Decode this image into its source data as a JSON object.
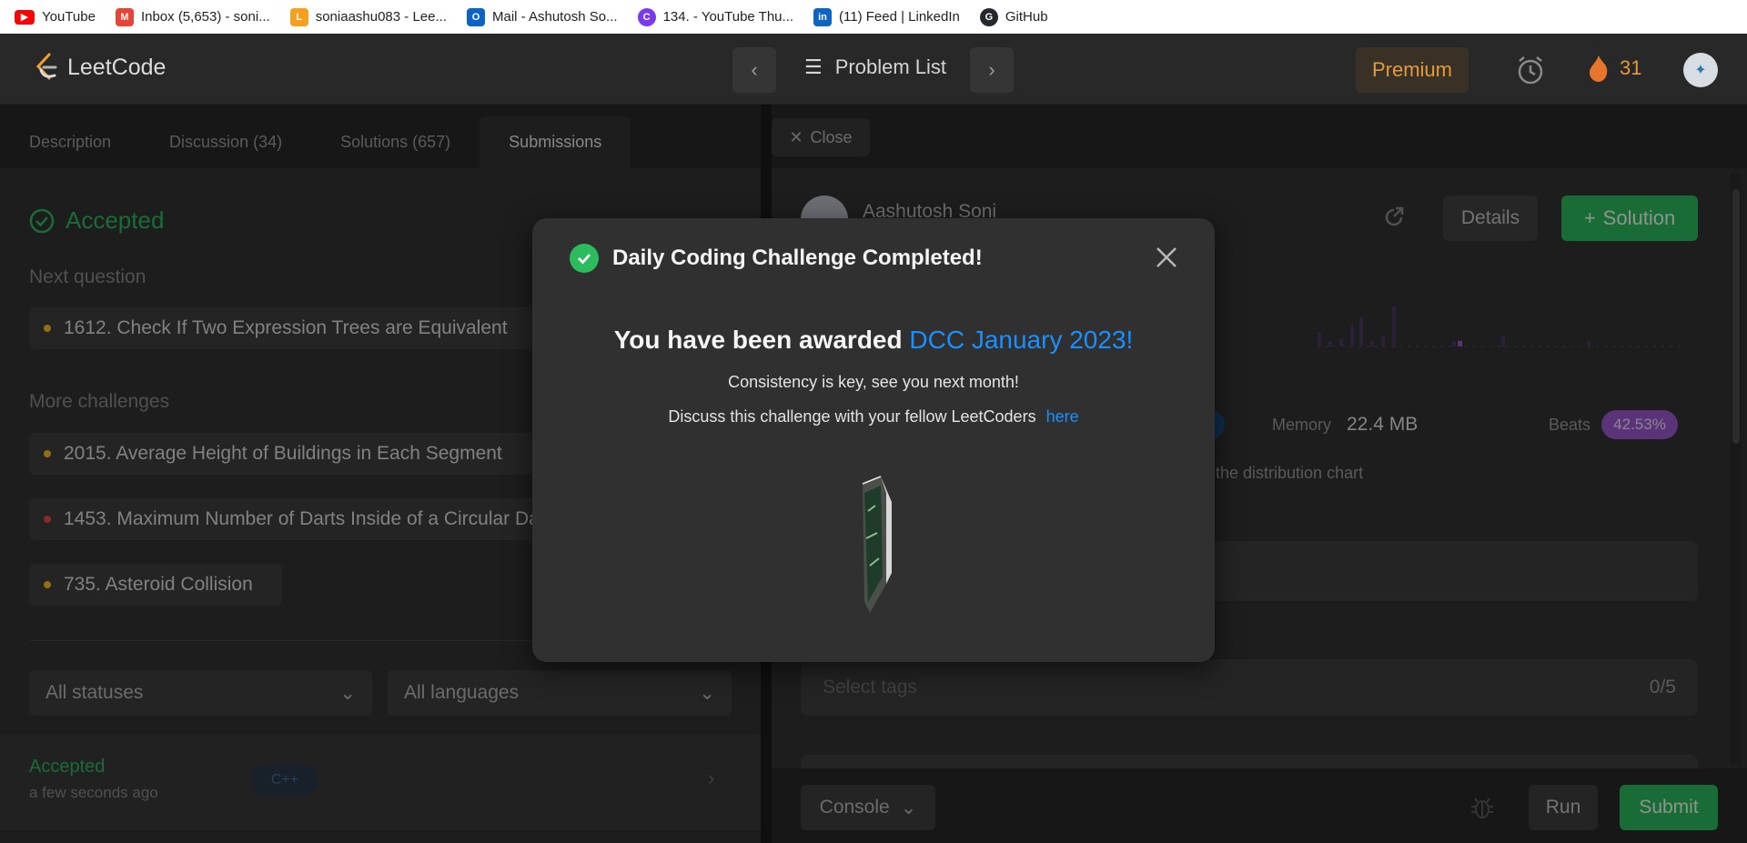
{
  "bookmarks": [
    {
      "label": "YouTube",
      "icon": "youtube-icon",
      "color": "#ff0000"
    },
    {
      "label": "Inbox (5,653) - soni...",
      "icon": "gmail-icon",
      "color": "#ea4335"
    },
    {
      "label": "soniaashu083 - Lee...",
      "icon": "leetcode-icon",
      "color": "#f89f1b"
    },
    {
      "label": "Mail - Ashutosh So...",
      "icon": "outlook-icon",
      "color": "#0a64c8"
    },
    {
      "label": "134. - YouTube Thu...",
      "icon": "canva-icon",
      "color": "#7c3aed"
    },
    {
      "label": "(11) Feed | LinkedIn",
      "icon": "linkedin-icon",
      "color": "#0a66c2"
    },
    {
      "label": "GitHub",
      "icon": "github-icon",
      "color": "#24292e"
    }
  ],
  "nav": {
    "logo_text": "LeetCode",
    "problem_list": "Problem List",
    "premium": "Premium",
    "streak": "31"
  },
  "left": {
    "tabs": [
      "Description",
      "Discussion (34)",
      "Solutions (657)",
      "Submissions"
    ],
    "active_tab": "Submissions",
    "status": "Accepted",
    "next_question_label": "Next question",
    "next_question": "1612. Check If Two Expression Trees are Equivalent",
    "more_challenges_label": "More challenges",
    "challenges": [
      {
        "title": "2015. Average Height of Buildings in Each Segment",
        "difficulty_color": "#ffc01e"
      },
      {
        "title": "1453. Maximum Number of Darts Inside of a Circular Dartboard",
        "difficulty_color": "#ef4743"
      },
      {
        "title": "735. Asteroid Collision",
        "difficulty_color": "#ffc01e"
      }
    ],
    "filter_status": "All statuses",
    "filter_language": "All languages",
    "submission": {
      "status": "Accepted",
      "time": "a few seconds ago",
      "language": "C++"
    }
  },
  "right": {
    "close_label": "Close",
    "author": "Aashutosh Soni",
    "details_label": "Details",
    "solution_label": "Solution",
    "memory_label": "Memory",
    "memory_value": "22.4 MB",
    "beats_label": "Beats",
    "beats_value": "42.53%",
    "distribution_text": "k the distribution chart",
    "tags_placeholder": "Select tags",
    "tags_count": "0/5",
    "console_label": "Console",
    "run_label": "Run",
    "submit_label": "Submit"
  },
  "modal": {
    "title": "Daily Coding Challenge Completed!",
    "awarded_prefix": "You have been awarded",
    "awarded_badge": "DCC January 2023!",
    "consistency": "Consistency is key, see you next month!",
    "discuss_text": "Discuss this challenge with your fellow LeetCoders",
    "discuss_link": "here"
  },
  "colors": {
    "accent_green": "#2cbb5d",
    "link_blue": "#1a90ff",
    "premium_orange": "#e39a3a",
    "beats_purple": "#9b59d0"
  }
}
